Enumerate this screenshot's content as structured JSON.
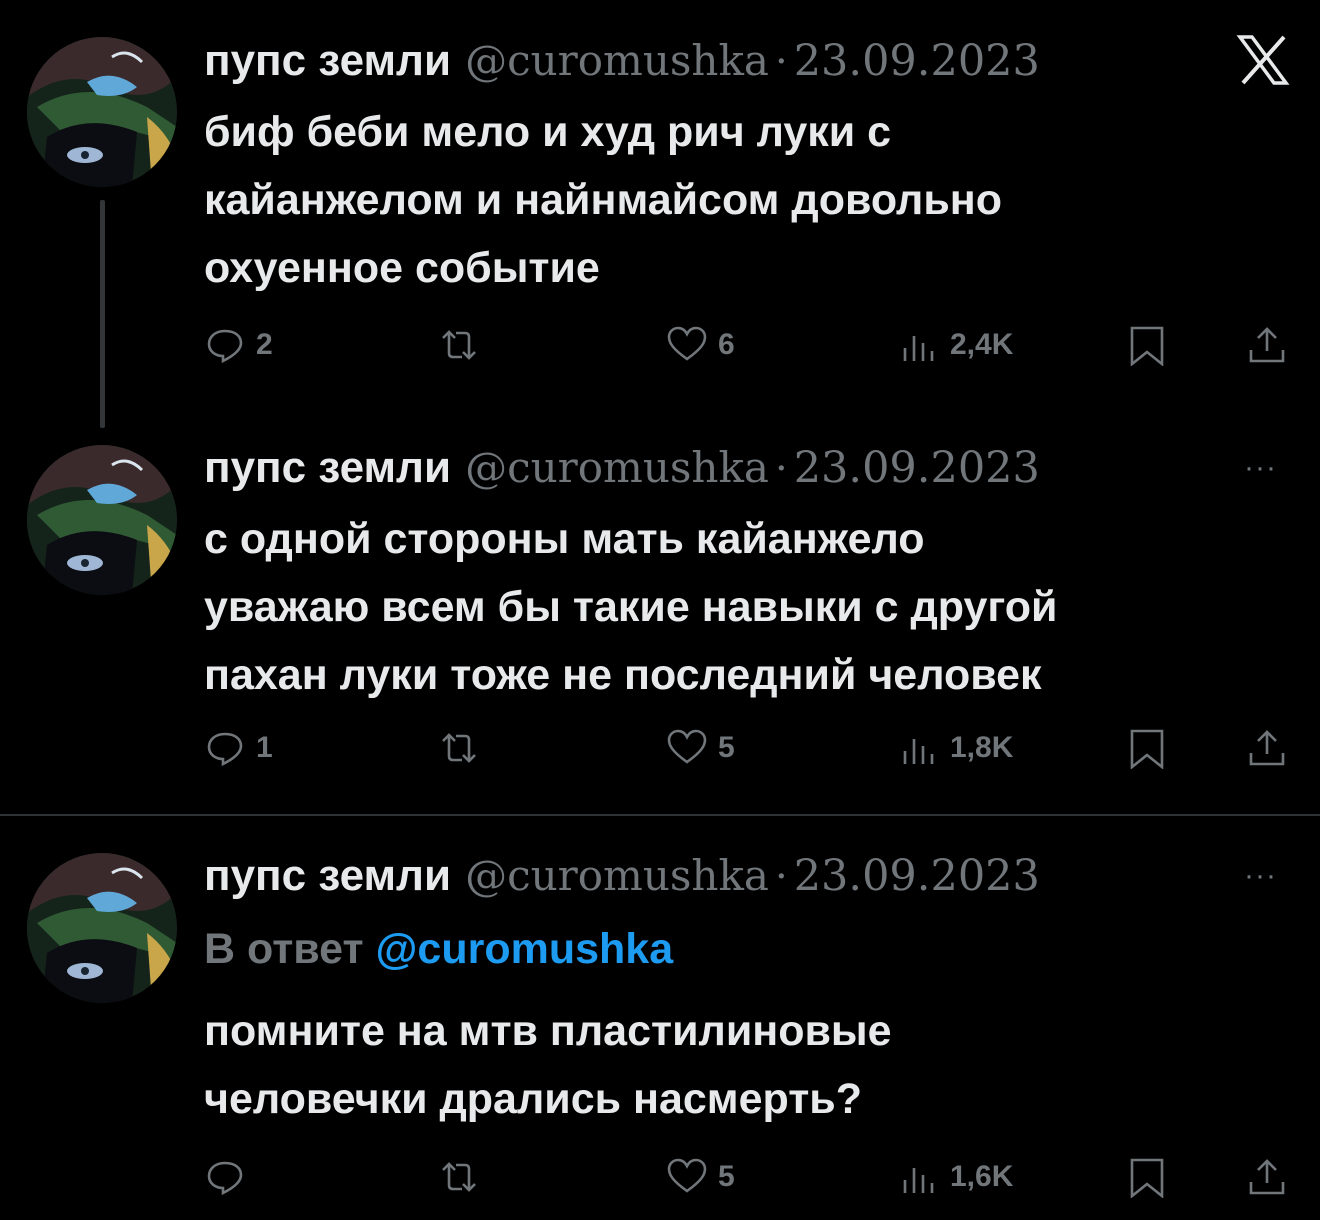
{
  "colors": {
    "background": "#000000",
    "text": "#e7e9ea",
    "muted": "#71767b",
    "link": "#1d9bf0"
  },
  "app": {
    "logo": "x-logo"
  },
  "tweets": [
    {
      "name": "пупс земли",
      "handle": "@curomushka",
      "separator": "·",
      "date": "23.09.2023",
      "lines": [
        "биф беби мело и худ рич луки с",
        "кайанжелом и найнмайсом довольно",
        "охуенное событие"
      ],
      "replies": "2",
      "retweets": "",
      "likes": "6",
      "views": "2,4K"
    },
    {
      "name": "пупс земли",
      "handle": "@curomushka",
      "separator": "·",
      "date": "23.09.2023",
      "more": "···",
      "lines": [
        "с одной стороны мать кайанжело",
        "уважаю всем бы такие навыки с другой",
        "пахан луки тоже не последний человек"
      ],
      "replies": "1",
      "retweets": "",
      "likes": "5",
      "views": "1,8K"
    },
    {
      "name": "пупс земли",
      "handle": "@curomushka",
      "separator": "·",
      "date": "23.09.2023",
      "more": "···",
      "reply_prefix": "В ответ",
      "reply_mention": "@curomushka",
      "lines": [
        "помните на мтв пластилиновые",
        "человечки дрались насмерть?"
      ],
      "replies": "",
      "retweets": "",
      "likes": "5",
      "views": "1,6K"
    }
  ]
}
